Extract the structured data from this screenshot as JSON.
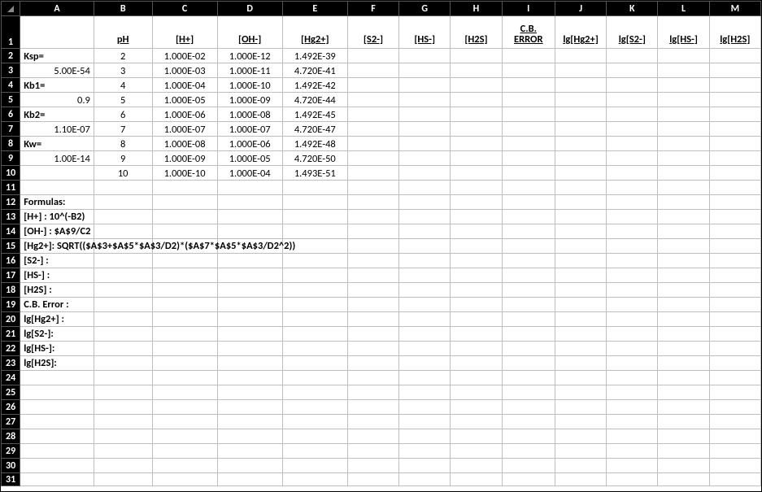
{
  "columns": [
    "A",
    "B",
    "C",
    "D",
    "E",
    "F",
    "G",
    "H",
    "I",
    "J",
    "K",
    "L",
    "M"
  ],
  "rowcount": 31,
  "headers": {
    "B": "pH",
    "C": "[H+]",
    "D": "[OH-]",
    "E": "[Hg2+]",
    "F": "[S2-]",
    "G": "[HS-]",
    "H": "[H2S]",
    "I_top": "C.B.",
    "I_bot": "ERROR",
    "J": "lg[Hg2+]",
    "K": "lg[S2-]",
    "L": "lg[HS-]",
    "M": "lg[H2S]"
  },
  "chart_data": {
    "type": "table",
    "constants": {
      "Ksp": "5.00E-54",
      "Kb1": "0.9",
      "Kb2": "1.10E-07",
      "Kw": "1.00E-14"
    },
    "columns": [
      "pH",
      "[H+]",
      "[OH-]",
      "[Hg2+]"
    ],
    "rows": [
      {
        "pH": 2,
        "H": "1.000E-02",
        "OH": "1.000E-12",
        "Hg": "1.492E-39"
      },
      {
        "pH": 3,
        "H": "1.000E-03",
        "OH": "1.000E-11",
        "Hg": "4.720E-41"
      },
      {
        "pH": 4,
        "H": "1.000E-04",
        "OH": "1.000E-10",
        "Hg": "1.492E-42"
      },
      {
        "pH": 5,
        "H": "1.000E-05",
        "OH": "1.000E-09",
        "Hg": "4.720E-44"
      },
      {
        "pH": 6,
        "H": "1.000E-06",
        "OH": "1.000E-08",
        "Hg": "1.492E-45"
      },
      {
        "pH": 7,
        "H": "1.000E-07",
        "OH": "1.000E-07",
        "Hg": "4.720E-47"
      },
      {
        "pH": 8,
        "H": "1.000E-08",
        "OH": "1.000E-06",
        "Hg": "1.492E-48"
      },
      {
        "pH": 9,
        "H": "1.000E-09",
        "OH": "1.000E-05",
        "Hg": "4.720E-50"
      },
      {
        "pH": 10,
        "H": "1.000E-10",
        "OH": "1.000E-04",
        "Hg": "1.493E-51"
      }
    ]
  },
  "labels": {
    "Ksp": "Ksp=",
    "Kb1": "Kb1=",
    "Kb2": "Kb2=",
    "Kw": "Kw=",
    "KspV": "5.00E-54",
    "Kb1V": "0.9",
    "Kb2V": "1.10E-07",
    "KwV": "1.00E-14"
  },
  "formulas": {
    "title": "Formulas:",
    "f13": "[H+] : 10^(-B2)",
    "f14": "[OH-] : $A$9/C2",
    "f15": "[Hg2+]: SQRT(($A$3+$A$5*$A$3/D2)*($A$7*$A$5*$A$3/D2^2))",
    "f16": "[S2-] :",
    "f17": "[HS-] :",
    "f18": "[H2S] :",
    "f19": "C.B. Error :",
    "f20": "lg[Hg2+] :",
    "f21": "lg[S2-]:",
    "f22": "lg[HS-]:",
    "f23": "lg[H2S]:"
  }
}
